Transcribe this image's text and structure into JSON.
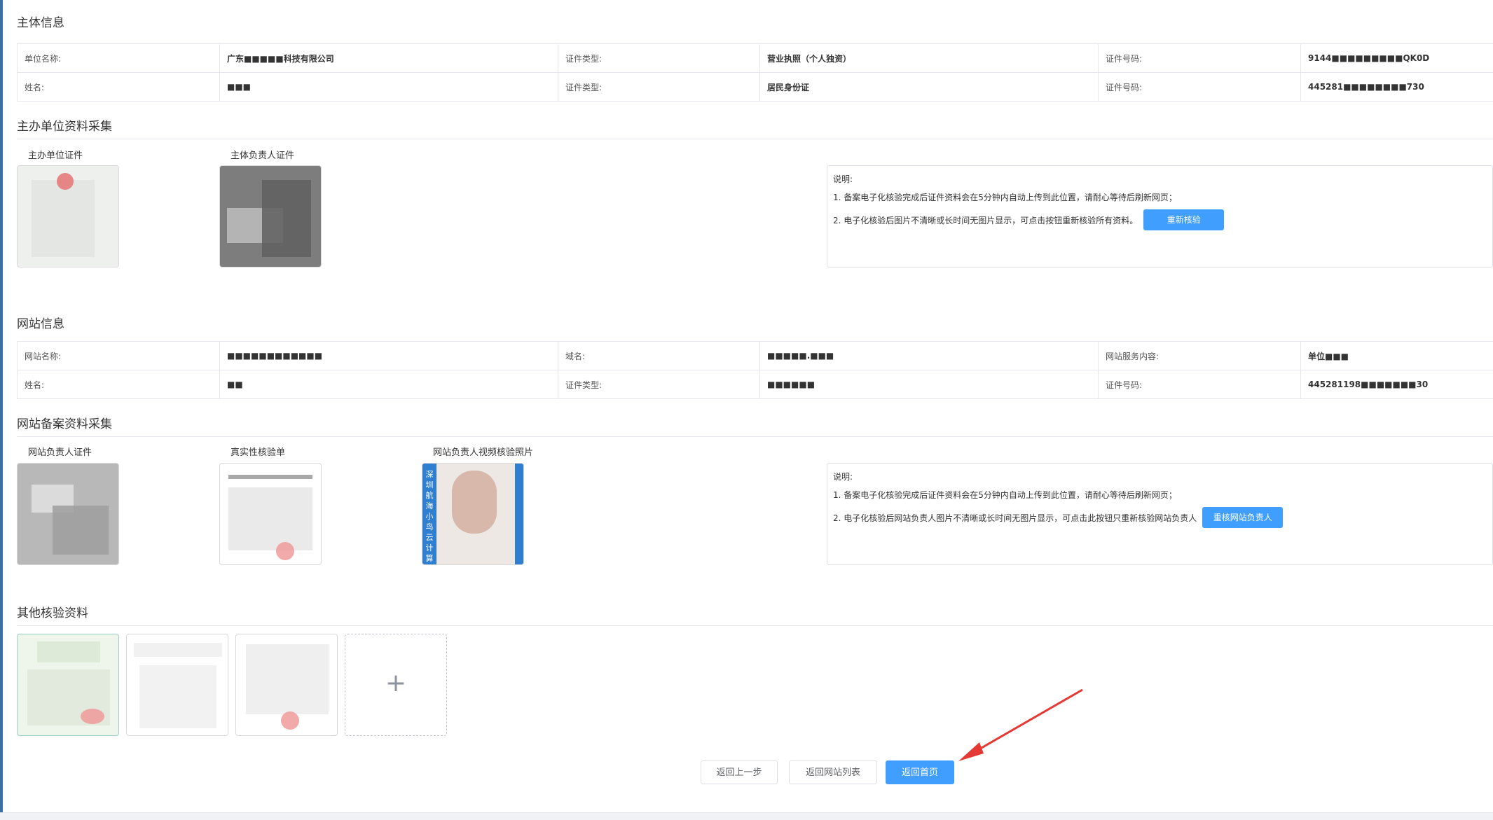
{
  "sections": {
    "subject_info": "主体信息",
    "host_collect": "主办单位资料采集",
    "site_info": "网站信息",
    "site_collect": "网站备案资料采集",
    "other": "其他核验资料"
  },
  "subject_table": [
    [
      "单位名称:",
      "广东■■■■■科技有限公司",
      "证件类型:",
      "营业执照（个人独资）",
      "证件号码:",
      "9144■■■■■■■■■QK0D"
    ],
    [
      "姓名:",
      "■■■",
      "证件类型:",
      "居民身份证",
      "证件号码:",
      "445281■■■■■■■■730"
    ]
  ],
  "site_table": [
    [
      "网站名称:",
      "■■■■■■■■■■■■",
      "域名:",
      "■■■■■.■■■",
      "网站服务内容:",
      "单位■■■"
    ],
    [
      "姓名:",
      "■■",
      "证件类型:",
      "■■■■■■",
      "证件号码:",
      "445281198■■■■■■■30"
    ]
  ],
  "host_thumbs": [
    "主办单位证件",
    "主体负责人证件"
  ],
  "site_thumbs": [
    "网站负责人证件",
    "真实性核验单",
    "网站负责人视频核验照片"
  ],
  "note1": {
    "title": "说明:",
    "line1": "1. 备案电子化核验完成后证件资料会在5分钟内自动上传到此位置，请耐心等待后刷新网页；",
    "line2": "2. 电子化核验后图片不清晰或长时间无图片显示，可点击按钮重新核验所有资料。",
    "button": "重新核验"
  },
  "note2": {
    "title": "说明:",
    "line1": "1. 备案电子化核验完成后证件资料会在5分钟内自动上传到此位置，请耐心等待后刷新网页；",
    "line2": "2. 电子化核验后网站负责人图片不清晰或长时间无图片显示，可点击此按钮只重新核验网站负责人",
    "button": "重核网站负责人"
  },
  "photo_side_text": "深圳航海小鸟云计算有限公司",
  "upload_plus": "+",
  "buttons": {
    "back_step": "返回上一步",
    "back_list": "返回网站列表",
    "back_home": "返回首页"
  },
  "colors": {
    "primary": "#409eff",
    "arrow": "#e53935"
  }
}
